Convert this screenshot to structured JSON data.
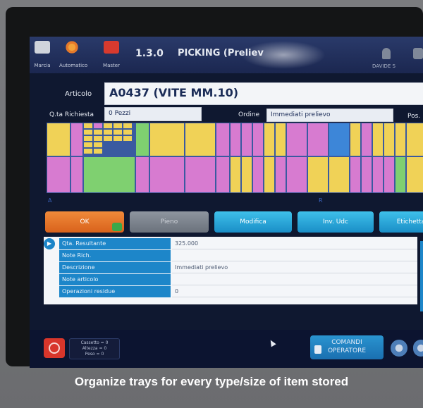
{
  "header": {
    "tools": [
      {
        "label": "Marcia",
        "icon": "marcia-icon"
      },
      {
        "label": "Automatico",
        "icon": "gear-icon"
      },
      {
        "label": "Master",
        "icon": "master-icon"
      }
    ],
    "version": "1.3.0",
    "mode_title": "PICKING (Preliev",
    "user": "DAVIDE S"
  },
  "fields": {
    "articolo_label": "Articolo",
    "articolo_value": "A0437 (VITE MM.10)",
    "qta_label": "Q.ta Richiesta",
    "qta_value": "0 Pezzi",
    "ordine_label": "Ordine",
    "ordine_value": "Immediati prelievo",
    "pos_label": "Pos."
  },
  "tray": {
    "label_left": "A",
    "label_right": "R",
    "colors": {
      "yellow": "#f0d257",
      "pink": "#d77bd0",
      "green": "#7fd070",
      "blue": "#3d86d8",
      "border": "#3a5aa0"
    }
  },
  "buttons": {
    "ok": "OK",
    "pieno": "Pieno",
    "modifica": "Modifica",
    "inv_udc": "Inv. Udc",
    "etichetta": "Etichetta"
  },
  "info": {
    "rows": [
      {
        "label": "Qta. Resultante",
        "value": "325.000"
      },
      {
        "label": "Note Rich.",
        "value": ""
      },
      {
        "label": "Descrizione",
        "value": "Immediati prelievo"
      },
      {
        "label": "Note articolo",
        "value": ""
      },
      {
        "label": "Operazioni residue",
        "value": "0"
      }
    ]
  },
  "footer": {
    "status_lines": [
      "Cassetto = 0",
      "Altezza = 0",
      "Peso = 0"
    ],
    "comandi_line1": "COMANDI",
    "comandi_line2": "OPERATORE"
  },
  "caption": "Organize trays for every type/size of item stored",
  "colors": {
    "accent": "#1d86c9",
    "ok": "#e5792a",
    "stop": "#d8362b"
  }
}
